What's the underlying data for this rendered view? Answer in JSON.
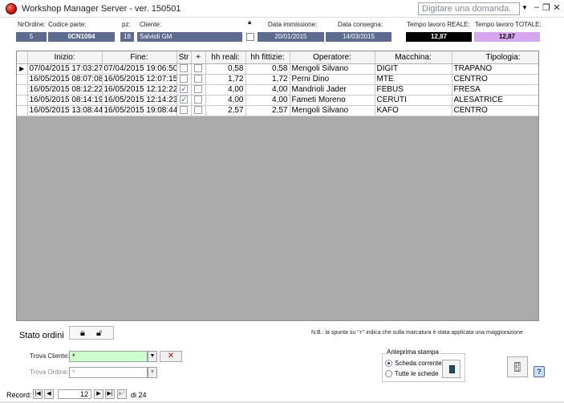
{
  "window": {
    "title": "Workshop Manager Server - ver. 150501",
    "help_placeholder": "Digitare una domanda."
  },
  "header": {
    "nr_ordine_label": "NrOrdine:",
    "nr_ordine": "5",
    "codice_parte_label": "Codice parte:",
    "codice_parte": "0CN1094",
    "pz_label": "pz:",
    "pz": "18",
    "cliente_label": "Cliente:",
    "cliente": "Salvioli GM",
    "data_immissione_label": "Data immissione:",
    "data_immissione": "20/01/2015",
    "data_consegna_label": "Data consegna:",
    "data_consegna": "14/03/2015",
    "tempo_reale_label": "Tempo lavoro REALE:",
    "tempo_reale": "12,87",
    "tempo_totale_label": "Tempo lavoro TOTALE:",
    "tempo_totale": "12,87"
  },
  "grid": {
    "columns": [
      "Inizio:",
      "Fine:",
      "Str",
      "+",
      "hh reali:",
      "hh fittizie:",
      "Operatore:",
      "Macchina:",
      "Tipologia:"
    ],
    "rows": [
      {
        "inizio": "07/04/2015 17:03:27",
        "fine": "07/04/2015 19:06:50",
        "str": false,
        "plus": false,
        "hh_reali": "0,58",
        "hh_fittizie": "0,58",
        "operatore": "Mengoli Silvano",
        "macchina": "DIGIT",
        "tipologia": "TRAPANO"
      },
      {
        "inizio": "16/05/2015 08:07:08",
        "fine": "16/05/2015 12:07:15",
        "str": false,
        "plus": false,
        "hh_reali": "1,72",
        "hh_fittizie": "1,72",
        "operatore": "Perni Dino",
        "macchina": "MTE",
        "tipologia": "CENTRO"
      },
      {
        "inizio": "16/05/2015 08:12:22",
        "fine": "16/05/2015 12:12:22",
        "str": true,
        "plus": false,
        "hh_reali": "4,00",
        "hh_fittizie": "4,00",
        "operatore": "Mandrioli Jader",
        "macchina": "FEBUS",
        "tipologia": "FRESA"
      },
      {
        "inizio": "16/05/2015 08:14:19",
        "fine": "16/05/2015 12:14:23",
        "str": true,
        "plus": false,
        "hh_reali": "4,00",
        "hh_fittizie": "4,00",
        "operatore": "Fameti Moreno",
        "macchina": "CERUTI",
        "tipologia": "ALESATRICE"
      },
      {
        "inizio": "16/05/2015 13:08:44",
        "fine": "16/05/2015 19:08:44",
        "str": false,
        "plus": false,
        "hh_reali": "2,57",
        "hh_fittizie": "2,57",
        "operatore": "Mengoli Silvano",
        "macchina": "KAFO",
        "tipologia": "CENTRO"
      }
    ]
  },
  "bottom": {
    "stato_ordini": "Stato ordini",
    "note": "N.B.: la spunta su \"+\" indica che sulla marcatura è stata applicata una maggiorazione",
    "trova_cliente_label": "Trova Cliente:",
    "trova_cliente_value": "*",
    "trova_ordine_label": "Trova Ordine:",
    "trova_ordine_value": "*",
    "anteprima_title": "Anteprima stampa",
    "scheda_corrente": "Scheda corrente",
    "tutte_schede": "Tutte le schede"
  },
  "navigator": {
    "label": "Record:",
    "current": "12",
    "total": "di 24"
  }
}
